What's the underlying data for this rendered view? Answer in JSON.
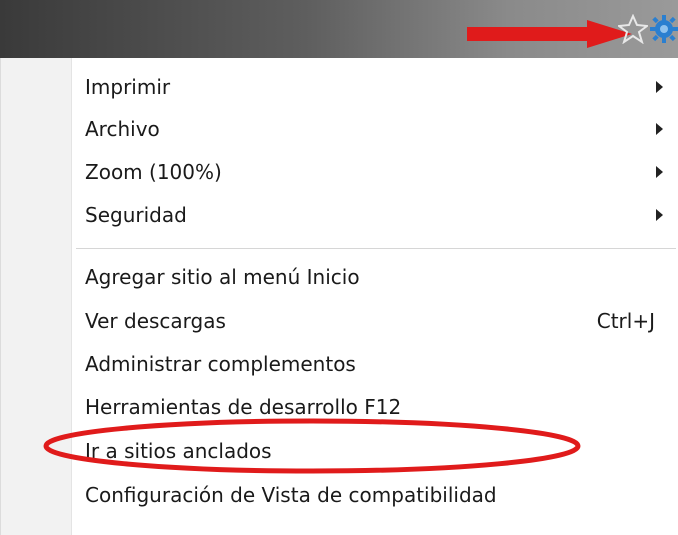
{
  "toolbar": {
    "arrow_color": "#e01b1b",
    "gear_color": "#2a7fd0",
    "star_icon": "star-icon",
    "gear_icon": "gear-icon"
  },
  "menu": {
    "items": [
      {
        "label": "Imprimir",
        "submenu": true
      },
      {
        "label": "Archivo",
        "submenu": true
      },
      {
        "label": "Zoom (100%)",
        "submenu": true
      },
      {
        "label": "Seguridad",
        "submenu": true
      },
      {
        "label": "Agregar sitio al menú Inicio"
      },
      {
        "label": "Ver descargas",
        "shortcut": "Ctrl+J"
      },
      {
        "label": "Administrar complementos"
      },
      {
        "label": "Herramientas de desarrollo F12"
      },
      {
        "label": "Ir a sitios anclados"
      },
      {
        "label": "Configuración de Vista de compatibilidad",
        "highlighted": true
      }
    ]
  },
  "annotation": {
    "ellipse_color": "#e01b1b"
  }
}
